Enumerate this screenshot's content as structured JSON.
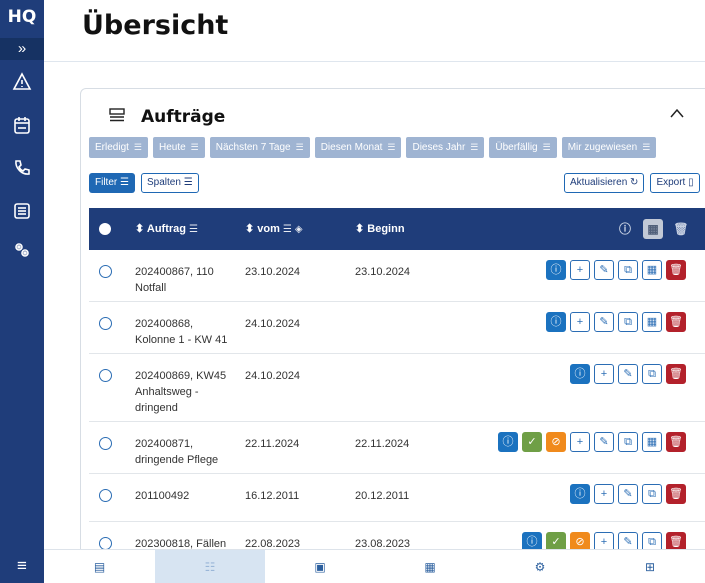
{
  "sidebar": {
    "logo": "HQ",
    "expand": "»",
    "icons": [
      "warning-icon",
      "calendar-icon",
      "phone-icon",
      "list-icon",
      "settings-icon"
    ],
    "menu": "≡"
  },
  "page": {
    "title": "Übersicht"
  },
  "card": {
    "title": "Aufträge",
    "collapse": "^",
    "presets": [
      "Erledigt",
      "Heute",
      "Nächsten 7 Tage",
      "Diesen Monat",
      "Dieses Jahr",
      "Überfällig",
      "Mir zugewiesen"
    ],
    "filter_label": "Filter",
    "columns_label": "Spalten",
    "refresh_label": "Aktualisieren",
    "export_label": "Export"
  },
  "table": {
    "headers": {
      "auftrag": "Auftrag",
      "vom": "vom",
      "beginn": "Beginn"
    },
    "rows": [
      {
        "auftrag": "202400867, 110 Notfall",
        "vom": "23.10.2024",
        "beginn": "23.10.2024",
        "actions": [
          "info",
          "add",
          "edit",
          "copy",
          "map",
          "delete"
        ]
      },
      {
        "auftrag": "202400868, Kolonne 1 - KW 41",
        "vom": "24.10.2024",
        "beginn": "",
        "actions": [
          "info",
          "add",
          "edit",
          "copy",
          "map",
          "delete"
        ]
      },
      {
        "auftrag": "202400869, KW45 Anhaltsweg - dringend",
        "vom": "24.10.2024",
        "beginn": "",
        "actions": [
          "info",
          "add",
          "edit",
          "copy",
          "delete"
        ]
      },
      {
        "auftrag": "202400871, dringende Pflege",
        "vom": "22.11.2024",
        "beginn": "22.11.2024",
        "actions": [
          "info",
          "done",
          "cancel",
          "add",
          "edit",
          "copy",
          "map",
          "delete"
        ]
      },
      {
        "auftrag": "201100492",
        "vom": "16.12.2011",
        "beginn": "20.12.2011",
        "actions": [
          "info",
          "add",
          "edit",
          "copy",
          "delete"
        ]
      },
      {
        "auftrag": "202300818, Fällen",
        "vom": "22.08.2023",
        "beginn": "23.08.2023",
        "actions": [
          "info",
          "done",
          "cancel",
          "add",
          "edit",
          "copy",
          "delete"
        ]
      }
    ]
  },
  "bottomnav": {
    "items": [
      "clipboard-icon",
      "list-icon",
      "calendar-check-icon",
      "map-icon",
      "settings-icon",
      "table-icon"
    ],
    "active_index": 1
  }
}
